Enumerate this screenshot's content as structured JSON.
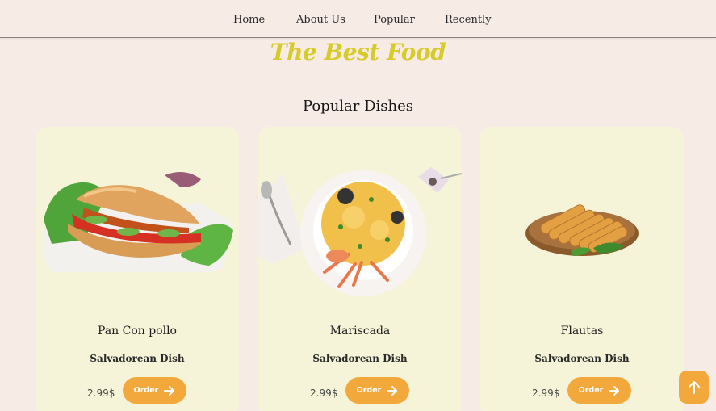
{
  "nav": {
    "items": [
      "Home",
      "About Us",
      "Popular",
      "Recently"
    ]
  },
  "brand": {
    "title": "The Best Food"
  },
  "section": {
    "title": "Popular Dishes"
  },
  "dishes": [
    {
      "name": "Pan Con pollo",
      "subtitle": "Salvadorean Dish",
      "price": "2.99$",
      "order_label": "Order",
      "image": "sandwich-image"
    },
    {
      "name": "Mariscada",
      "subtitle": "Salvadorean Dish",
      "price": "2.99$",
      "order_label": "Order",
      "image": "seafood-soup-image"
    },
    {
      "name": "Flautas",
      "subtitle": "Salvadorean Dish",
      "price": "2.99$",
      "order_label": "Order",
      "image": "flautas-image"
    }
  ],
  "icons": {
    "order_arrow": "arrow-right-icon",
    "scroll_top": "arrow-up-icon"
  },
  "colors": {
    "background": "#f7ebe6",
    "card": "#f5f4d8",
    "brand": "#d7cb2a",
    "accent": "#f3a83c"
  }
}
